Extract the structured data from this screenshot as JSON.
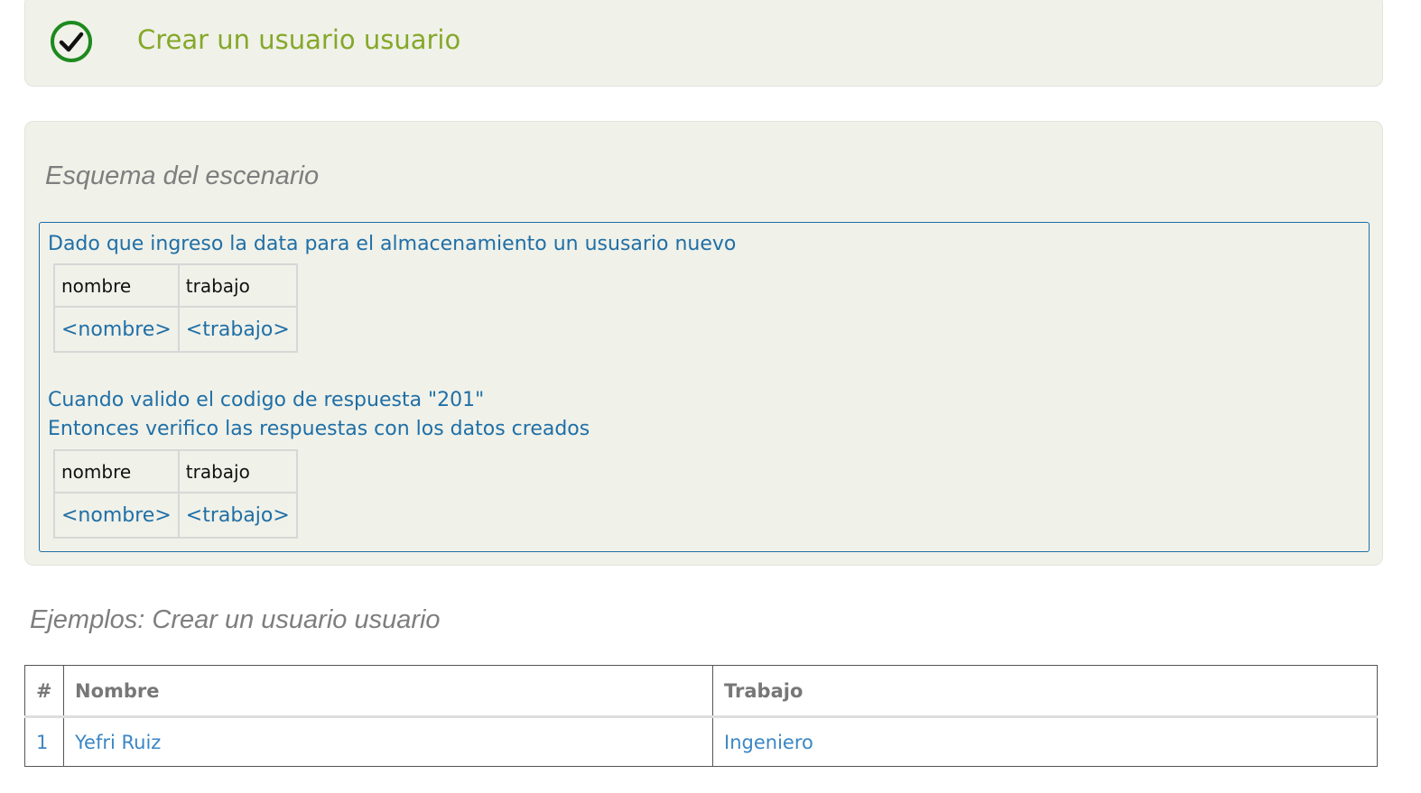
{
  "scenario": {
    "title": "Crear un usuario usuario",
    "status_icon": "check-circle-icon",
    "status_color": "#1e8a1e",
    "title_color": "#85a829"
  },
  "outline": {
    "heading": "Esquema del escenario",
    "steps": [
      {
        "text": "Dado que ingreso la data para el almacenamiento un ususario nuevo",
        "table": {
          "headers": [
            "nombre",
            "trabajo"
          ],
          "values": [
            "<nombre>",
            "<trabajo>"
          ]
        }
      },
      {
        "text": "Cuando valido el codigo de respuesta \"201\""
      },
      {
        "text": "Entonces verifico las respuestas con los datos creados",
        "table": {
          "headers": [
            "nombre",
            "trabajo"
          ],
          "values": [
            "<nombre>",
            "<trabajo>"
          ]
        }
      }
    ]
  },
  "examples": {
    "heading": "Ejemplos: Crear un usuario usuario",
    "columns": [
      "#",
      "Nombre",
      "Trabajo"
    ],
    "rows": [
      [
        "1",
        "Yefri Ruiz",
        "Ingeniero"
      ]
    ]
  }
}
